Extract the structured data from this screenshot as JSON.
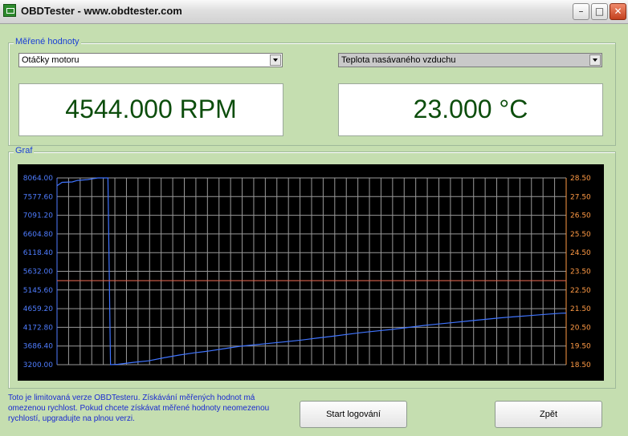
{
  "window": {
    "title": "OBDTester - www.obdtester.com"
  },
  "measured": {
    "group_label": "Měřené hodnoty",
    "left": {
      "selected": "Otáčky motoru",
      "value": "4544.000 RPM"
    },
    "right": {
      "selected": "Teplota nasávaného vzduchu",
      "value": "23.000 °C"
    }
  },
  "graph": {
    "group_label": "Graf"
  },
  "notice": "Toto je limitovaná verze OBDTesteru. Získávání měřených hodnot má omezenou rychlost. Pokud chcete získávat měřené hodnoty neomezenou rychlostí, upgradujte na plnou verzi.",
  "buttons": {
    "start": "Start logování",
    "back": "Zpět"
  },
  "colors": {
    "background": "#c5deb0",
    "left_axis": "#4f7dff",
    "right_axis": "#ff9a45",
    "rpm_line": "#3f74ff",
    "temp_line": "#d9604a",
    "grid": "#9a9a9a"
  },
  "chart_data": {
    "type": "line",
    "grid": true,
    "y_left": {
      "ticks": [
        "8064.00",
        "7577.60",
        "7091.20",
        "6604.80",
        "6118.40",
        "5632.00",
        "5145.60",
        "4659.20",
        "4172.80",
        "3686.40",
        "3200.00"
      ],
      "range": [
        3200,
        8064
      ]
    },
    "y_right": {
      "ticks": [
        "28.50",
        "27.50",
        "26.50",
        "25.50",
        "24.50",
        "23.50",
        "22.50",
        "21.50",
        "20.50",
        "19.50",
        "18.50"
      ],
      "range": [
        18.5,
        28.5
      ]
    },
    "series": [
      {
        "axis": "left",
        "x": [
          0,
          1,
          3,
          4,
          6,
          8,
          10,
          10.5,
          12,
          15,
          18,
          21,
          24,
          27,
          30,
          33,
          36,
          39,
          42,
          45,
          48,
          51,
          54,
          57,
          60,
          63,
          66,
          69,
          72,
          75,
          78,
          81,
          84,
          87,
          90,
          93,
          96,
          99,
          100
        ],
        "values": [
          7860,
          7950,
          7960,
          8000,
          8020,
          8064,
          8064,
          3200,
          3210,
          3260,
          3300,
          3380,
          3450,
          3510,
          3560,
          3620,
          3680,
          3720,
          3760,
          3800,
          3840,
          3890,
          3940,
          3990,
          4040,
          4080,
          4120,
          4170,
          4220,
          4260,
          4300,
          4340,
          4380,
          4420,
          4450,
          4480,
          4510,
          4540,
          4544
        ]
      },
      {
        "axis": "right",
        "x": [
          0,
          100
        ],
        "values": [
          23.0,
          23.0
        ]
      }
    ]
  }
}
